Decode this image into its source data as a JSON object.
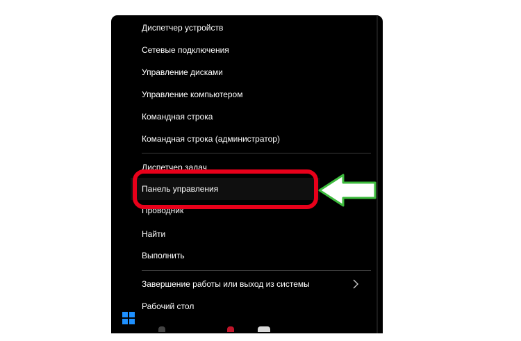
{
  "menu": {
    "items": [
      {
        "label": "Диспетчер устройств"
      },
      {
        "label": "Сетевые подключения"
      },
      {
        "label": "Управление дисками"
      },
      {
        "label": "Управление компьютером"
      },
      {
        "label": "Командная строка"
      },
      {
        "label": "Командная строка (администратор)"
      },
      {
        "label": "Диспетчер задач"
      },
      {
        "label": "Панель управления"
      },
      {
        "label": "Проводник"
      },
      {
        "label": "Найти"
      },
      {
        "label": "Выполнить"
      },
      {
        "label": "Завершение работы или выход из системы"
      },
      {
        "label": "Рабочий стол"
      }
    ]
  },
  "annotations": {
    "outline_color": "#e8001a",
    "arrow_color": "#3dbb3d"
  },
  "taskbar": {
    "start_icon": "windows-logo-icon",
    "accent": "#1e90ff"
  }
}
